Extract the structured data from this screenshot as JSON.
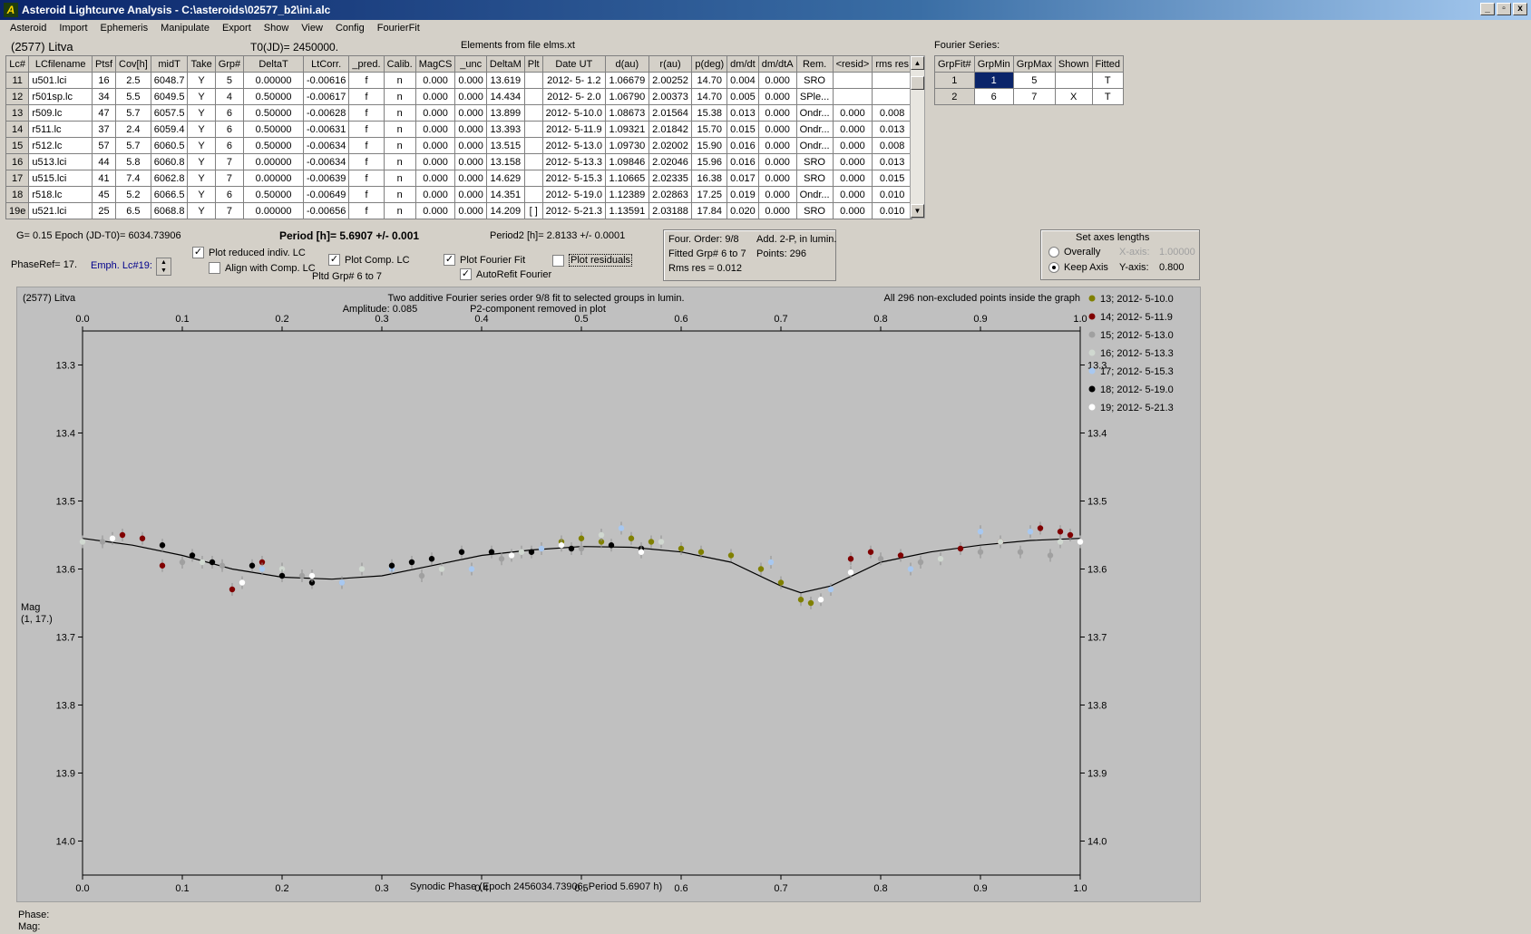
{
  "window": {
    "title": "Asteroid Lightcurve Analysis - C:\\asteroids\\02577_b2\\ini.alc",
    "buttons": [
      "_",
      "▫",
      "x"
    ]
  },
  "menu": [
    "Asteroid",
    "Import",
    "Ephemeris",
    "Manipulate",
    "Export",
    "Show",
    "View",
    "Config",
    "FourierFit"
  ],
  "header": {
    "asteroid": "(2577) Litva",
    "t0": "T0(JD)= 2450000.",
    "elements": "Elements from file elms.xt",
    "fourier_title": "Fourier Series:"
  },
  "lc_table": {
    "columns": [
      "Lc#",
      "LCfilename",
      "Ptsf",
      "Cov[h]",
      "midT",
      "Take",
      "Grp#",
      "DeltaT",
      "LtCorr.",
      "_pred.",
      "Calib.",
      "MagCS",
      "_unc",
      "DeltaM",
      "Plt",
      "Date UT",
      "d(au)",
      "r(au)",
      "p(deg)",
      "dm/dt",
      "dm/dtA",
      "Rem.",
      "<resid>",
      "rms res"
    ],
    "rows": [
      [
        "11",
        "u501.lci",
        "16",
        "2.5",
        "6048.7",
        "Y",
        "5",
        "0.00000",
        "-0.00616",
        "f",
        "n",
        "0.000",
        "0.000",
        "13.619",
        "",
        "2012- 5- 1.2",
        "1.06679",
        "2.00252",
        "14.70",
        "0.004",
        "0.000",
        "SRO",
        "",
        ""
      ],
      [
        "12",
        "r501sp.lc",
        "34",
        "5.5",
        "6049.5",
        "Y",
        "4",
        "0.50000",
        "-0.00617",
        "f",
        "n",
        "0.000",
        "0.000",
        "14.434",
        "",
        "2012- 5- 2.0",
        "1.06790",
        "2.00373",
        "14.70",
        "0.005",
        "0.000",
        "SPle...",
        "",
        ""
      ],
      [
        "13",
        "r509.lc",
        "47",
        "5.7",
        "6057.5",
        "Y",
        "6",
        "0.50000",
        "-0.00628",
        "f",
        "n",
        "0.000",
        "0.000",
        "13.899",
        "",
        "2012- 5-10.0",
        "1.08673",
        "2.01564",
        "15.38",
        "0.013",
        "0.000",
        "Ondr...",
        "0.000",
        "0.008"
      ],
      [
        "14",
        "r511.lc",
        "37",
        "2.4",
        "6059.4",
        "Y",
        "6",
        "0.50000",
        "-0.00631",
        "f",
        "n",
        "0.000",
        "0.000",
        "13.393",
        "",
        "2012- 5-11.9",
        "1.09321",
        "2.01842",
        "15.70",
        "0.015",
        "0.000",
        "Ondr...",
        "0.000",
        "0.013"
      ],
      [
        "15",
        "r512.lc",
        "57",
        "5.7",
        "6060.5",
        "Y",
        "6",
        "0.50000",
        "-0.00634",
        "f",
        "n",
        "0.000",
        "0.000",
        "13.515",
        "",
        "2012- 5-13.0",
        "1.09730",
        "2.02002",
        "15.90",
        "0.016",
        "0.000",
        "Ondr...",
        "0.000",
        "0.008"
      ],
      [
        "16",
        "u513.lci",
        "44",
        "5.8",
        "6060.8",
        "Y",
        "7",
        "0.00000",
        "-0.00634",
        "f",
        "n",
        "0.000",
        "0.000",
        "13.158",
        "",
        "2012- 5-13.3",
        "1.09846",
        "2.02046",
        "15.96",
        "0.016",
        "0.000",
        "SRO",
        "0.000",
        "0.013"
      ],
      [
        "17",
        "u515.lci",
        "41",
        "7.4",
        "6062.8",
        "Y",
        "7",
        "0.00000",
        "-0.00639",
        "f",
        "n",
        "0.000",
        "0.000",
        "14.629",
        "",
        "2012- 5-15.3",
        "1.10665",
        "2.02335",
        "16.38",
        "0.017",
        "0.000",
        "SRO",
        "0.000",
        "0.015"
      ],
      [
        "18",
        "r518.lc",
        "45",
        "5.2",
        "6066.5",
        "Y",
        "6",
        "0.50000",
        "-0.00649",
        "f",
        "n",
        "0.000",
        "0.000",
        "14.351",
        "",
        "2012- 5-19.0",
        "1.12389",
        "2.02863",
        "17.25",
        "0.019",
        "0.000",
        "Ondr...",
        "0.000",
        "0.010"
      ],
      [
        "19e",
        "u521.lci",
        "25",
        "6.5",
        "6068.8",
        "Y",
        "7",
        "0.00000",
        "-0.00656",
        "f",
        "n",
        "0.000",
        "0.000",
        "14.209",
        "[ ]",
        "2012- 5-21.3",
        "1.13591",
        "2.03188",
        "17.84",
        "0.020",
        "0.000",
        "SRO",
        "0.000",
        "0.010"
      ]
    ]
  },
  "fourier_table": {
    "columns": [
      "GrpFit#",
      "GrpMin",
      "GrpMax",
      "Shown",
      "Fitted"
    ],
    "rows": [
      [
        "1",
        "1",
        "5",
        "",
        "T"
      ],
      [
        "2",
        "6",
        "7",
        "X",
        "T"
      ]
    ]
  },
  "controls": {
    "g_epoch": "G= 0.15   Epoch (JD-T0)= 6034.73906",
    "period": "Period [h]= 5.6907 +/- 0.001",
    "period2": "Period2 [h]= 2.8133 +/- 0.0001",
    "phaseref": "PhaseRef= 17.",
    "emph": "Emph. Lc#19:",
    "plot_reduced": "Plot reduced indiv. LC",
    "align": "Align with Comp. LC",
    "plot_comp": "Plot Comp. LC",
    "pltd_grp": "Pltd Grp#  6   to   7",
    "plot_fourier": "Plot Fourier Fit",
    "autorefit": "AutoRefit Fourier",
    "plot_residuals": "Plot residuals",
    "info_order": "Four. Order:  9/8",
    "info_add": "Add. 2-P, in lumin.",
    "info_fitted": "Fitted Grp# 6 to 7",
    "info_points": "Points: 296",
    "info_rms": "Rms res      = 0.012",
    "axes_title": "Set axes lengths",
    "overally": "Overally",
    "keep_axis": "Keep Axis",
    "xaxis_label": "X-axis:",
    "xaxis_val": "1.00000",
    "yaxis_label": "Y-axis:",
    "yaxis_val": "0.800"
  },
  "footer": {
    "phase": "Phase:",
    "mag": "Mag:"
  },
  "chart_data": {
    "type": "scatter",
    "title": "Two additive Fourier series order 9/8 fit to selected groups in lumin.",
    "subtitle1": "Amplitude: 0.085",
    "subtitle2": "P2-component removed in plot",
    "corner_left": "(2577) Litva",
    "corner_right": "All 296 non-excluded points inside the graph",
    "xlabel": "Synodic Phase (Epoch 2456034.73906, Period 5.6907 h)",
    "ylabel": "Mag",
    "ylabel2": "(1, 17.)",
    "xlim": [
      0.0,
      1.0
    ],
    "ylim": [
      13.25,
      14.05
    ],
    "y_inverted": true,
    "xticks": [
      "0.0",
      "0.1",
      "0.2",
      "0.3",
      "0.4",
      "0.5",
      "0.6",
      "0.7",
      "0.8",
      "0.9",
      "1.0"
    ],
    "yticks": [
      "13.3",
      "13.4",
      "13.5",
      "13.6",
      "13.7",
      "13.8",
      "13.9",
      "14.0"
    ],
    "legend_position": "right",
    "fit_curve": {
      "x": [
        0.0,
        0.05,
        0.1,
        0.15,
        0.2,
        0.25,
        0.3,
        0.35,
        0.4,
        0.45,
        0.5,
        0.55,
        0.6,
        0.65,
        0.7,
        0.72,
        0.75,
        0.8,
        0.85,
        0.9,
        0.95,
        1.0
      ],
      "y": [
        13.555,
        13.565,
        13.58,
        13.6,
        13.612,
        13.615,
        13.61,
        13.595,
        13.58,
        13.572,
        13.567,
        13.568,
        13.575,
        13.59,
        13.625,
        13.635,
        13.625,
        13.59,
        13.575,
        13.565,
        13.558,
        13.555
      ]
    },
    "series": [
      {
        "name": "13; 2012- 5-10.0",
        "color": "#808000",
        "x": [
          0.48,
          0.5,
          0.52,
          0.55,
          0.57,
          0.6,
          0.62,
          0.65,
          0.68,
          0.7,
          0.72,
          0.73
        ],
        "y": [
          13.56,
          13.555,
          13.56,
          13.555,
          13.56,
          13.57,
          13.575,
          13.58,
          13.6,
          13.62,
          13.645,
          13.65
        ]
      },
      {
        "name": "14; 2012- 5-11.9",
        "color": "#800000",
        "x": [
          0.04,
          0.06,
          0.08,
          0.15,
          0.18,
          0.77,
          0.79,
          0.82,
          0.88,
          0.92,
          0.96,
          0.98,
          0.99
        ],
        "y": [
          13.55,
          13.555,
          13.595,
          13.63,
          13.59,
          13.585,
          13.575,
          13.58,
          13.57,
          13.56,
          13.54,
          13.545,
          13.55
        ]
      },
      {
        "name": "15; 2012- 5-13.0",
        "color": "#a0a0a0",
        "x": [
          0.02,
          0.1,
          0.14,
          0.22,
          0.26,
          0.34,
          0.42,
          0.5,
          0.8,
          0.84,
          0.9,
          0.94,
          0.97
        ],
        "y": [
          13.56,
          13.59,
          13.595,
          13.61,
          13.62,
          13.61,
          13.585,
          13.57,
          13.585,
          13.59,
          13.575,
          13.575,
          13.58
        ]
      },
      {
        "name": "16; 2012- 5-13.3",
        "color": "#d0d8d0",
        "x": [
          0.0,
          0.12,
          0.2,
          0.28,
          0.36,
          0.44,
          0.52,
          0.58,
          0.86,
          0.92,
          0.98
        ],
        "y": [
          13.56,
          13.59,
          13.6,
          13.6,
          13.6,
          13.575,
          13.55,
          13.56,
          13.585,
          13.56,
          13.56
        ]
      },
      {
        "name": "17; 2012- 5-15.3",
        "color": "#a8c8f0",
        "x": [
          0.18,
          0.26,
          0.31,
          0.39,
          0.46,
          0.54,
          0.69,
          0.75,
          0.83,
          0.9,
          0.95
        ],
        "y": [
          13.6,
          13.62,
          13.6,
          13.6,
          13.57,
          13.54,
          13.59,
          13.63,
          13.6,
          13.545,
          13.545
        ]
      },
      {
        "name": "18; 2012- 5-19.0",
        "color": "#000000",
        "x": [
          0.08,
          0.11,
          0.13,
          0.17,
          0.2,
          0.23,
          0.31,
          0.33,
          0.35,
          0.38,
          0.41,
          0.45,
          0.49,
          0.53,
          0.56
        ],
        "y": [
          13.565,
          13.58,
          13.59,
          13.595,
          13.61,
          13.62,
          13.595,
          13.59,
          13.585,
          13.575,
          13.575,
          13.575,
          13.57,
          13.565,
          13.57
        ]
      },
      {
        "name": "19; 2012- 5-21.3",
        "color": "#ffffff",
        "x": [
          0.03,
          0.16,
          0.23,
          0.43,
          0.48,
          0.56,
          0.74,
          0.77,
          1.0
        ],
        "y": [
          13.555,
          13.62,
          13.61,
          13.58,
          13.565,
          13.575,
          13.645,
          13.605,
          13.56
        ]
      }
    ]
  }
}
